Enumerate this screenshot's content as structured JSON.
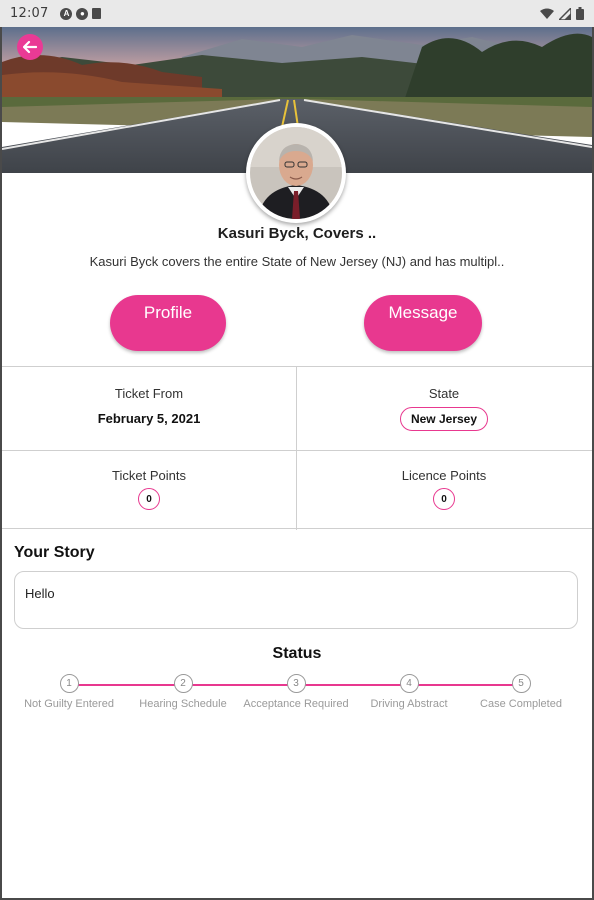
{
  "statusbar": {
    "time": "12:07",
    "left_icons": [
      "a-icon",
      "circle-icon",
      "sim-card-icon"
    ],
    "right_icons": [
      "wifi-icon",
      "signal-icon",
      "battery-icon"
    ]
  },
  "hero": {
    "back_icon": "arrow-left-icon"
  },
  "profile": {
    "name": "Kasuri Byck, Covers ..",
    "bio": "Kasuri Byck covers the entire State of New Jersey (NJ) and has multipl.."
  },
  "actions": {
    "profile_label": "Profile",
    "message_label": "Message"
  },
  "details": {
    "ticket_from_label": "Ticket From",
    "ticket_from_value": "February 5, 2021",
    "state_label": "State",
    "state_value": "New Jersey",
    "ticket_points_label": "Ticket Points",
    "ticket_points_value": "0",
    "licence_points_label": "Licence Points",
    "licence_points_value": "0"
  },
  "story": {
    "title": "Your Story",
    "text": "Hello"
  },
  "status": {
    "title": "Status",
    "steps": [
      {
        "number": "1",
        "label": "Not Guilty Entered"
      },
      {
        "number": "2",
        "label": "Hearing Schedule"
      },
      {
        "number": "3",
        "label": "Acceptance Required"
      },
      {
        "number": "4",
        "label": "Driving Abstract"
      },
      {
        "number": "5",
        "label": "Case Completed"
      }
    ]
  },
  "colors": {
    "accent": "#e8388f",
    "statusbar_bg": "#e9e9e9"
  }
}
